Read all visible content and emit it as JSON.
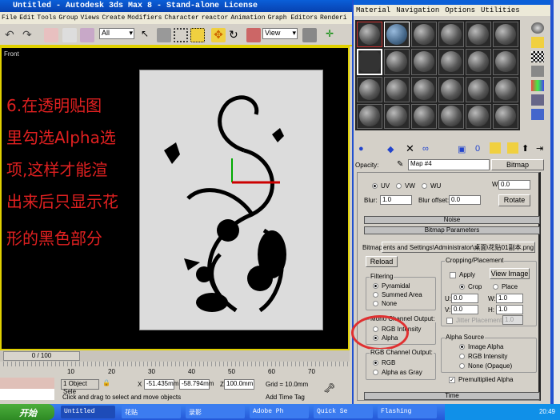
{
  "window": {
    "title": "Untitled - Autodesk 3ds Max 8  - Stand-alone License"
  },
  "menu": [
    "File",
    "Edit",
    "Tools",
    "Group",
    "Views",
    "Create",
    "Modifiers",
    "Character",
    "reactor",
    "Animation",
    "Graph Editors",
    "Renderi"
  ],
  "toolbar": {
    "selection_filter": "All",
    "ref_coord": "View"
  },
  "viewport": {
    "label": "Front",
    "caption": [
      "6.在透明贴图",
      "里勾选Alpha选",
      "项,这样才能渲",
      "出来后只显示花",
      "形的黑色部分"
    ]
  },
  "timeline": {
    "frame": "0 / 100",
    "ticks": [
      "10",
      "20",
      "30",
      "40",
      "50",
      "60",
      "70"
    ]
  },
  "status": {
    "selection": "1 Object Sele",
    "x": "-51.435mm",
    "y": "-58.794mm",
    "z": "100.0mm",
    "x_label": "X",
    "y_label": "Y",
    "z_label": "Z",
    "grid": "Grid = 10.0mm",
    "prompt": "Click and drag to select and move objects",
    "time_tag": "Add Time Tag"
  },
  "material_editor": {
    "menu": [
      "Material",
      "Navigation",
      "Options",
      "Utilities"
    ],
    "opacity_label": "Opacity:",
    "map_name": "Map #4",
    "map_type": "Bitmap",
    "uvw": [
      "UV",
      "VW",
      "WU"
    ],
    "w_label": "W:",
    "w_value": "0.0",
    "blur_label": "Blur:",
    "blur": "1.0",
    "blur_offset_label": "Blur offset:",
    "blur_offset": "0.0",
    "rotate": "Rotate",
    "noise": "Noise",
    "bitmap_params": "Bitmap Parameters",
    "time": "Time",
    "bitmap_label": "Bitmap:",
    "bitmap_path": "ents and Settings\\Administrator\\桌面\\花贴01副本.png",
    "reload": "Reload",
    "filtering": {
      "title": "Filtering",
      "options": [
        "Pyramidal",
        "Summed Area",
        "None"
      ]
    },
    "mono": {
      "title": "Mono Channel Output:",
      "options": [
        "RGB Intensity",
        "Alpha"
      ]
    },
    "rgb": {
      "title": "RGB Channel Output:",
      "options": [
        "RGB",
        "Alpha as Gray"
      ]
    },
    "crop": {
      "title": "Cropping/Placement",
      "apply": "Apply",
      "view_image": "View Image",
      "crop": "Crop",
      "place": "Place",
      "u": "0.0",
      "v": "0.0",
      "w": "1.0",
      "h": "1.0",
      "u_label": "U:",
      "v_label": "V:",
      "w_label": "W:",
      "h_label": "H:",
      "jitter": "Jitter Placement",
      "jitter_value": "1.0"
    },
    "alpha": {
      "title": "Alpha Source",
      "options": [
        "Image Alpha",
        "RGB Intensity",
        "None (Opaque)"
      ]
    },
    "premult": "Premultiplied Alpha"
  },
  "taskbar": {
    "start": "开始",
    "items": [
      "Untitled",
      "花贴",
      "录影",
      "Adobe Ph",
      "Quick Se",
      "Flashing"
    ],
    "clock": "20:49"
  }
}
